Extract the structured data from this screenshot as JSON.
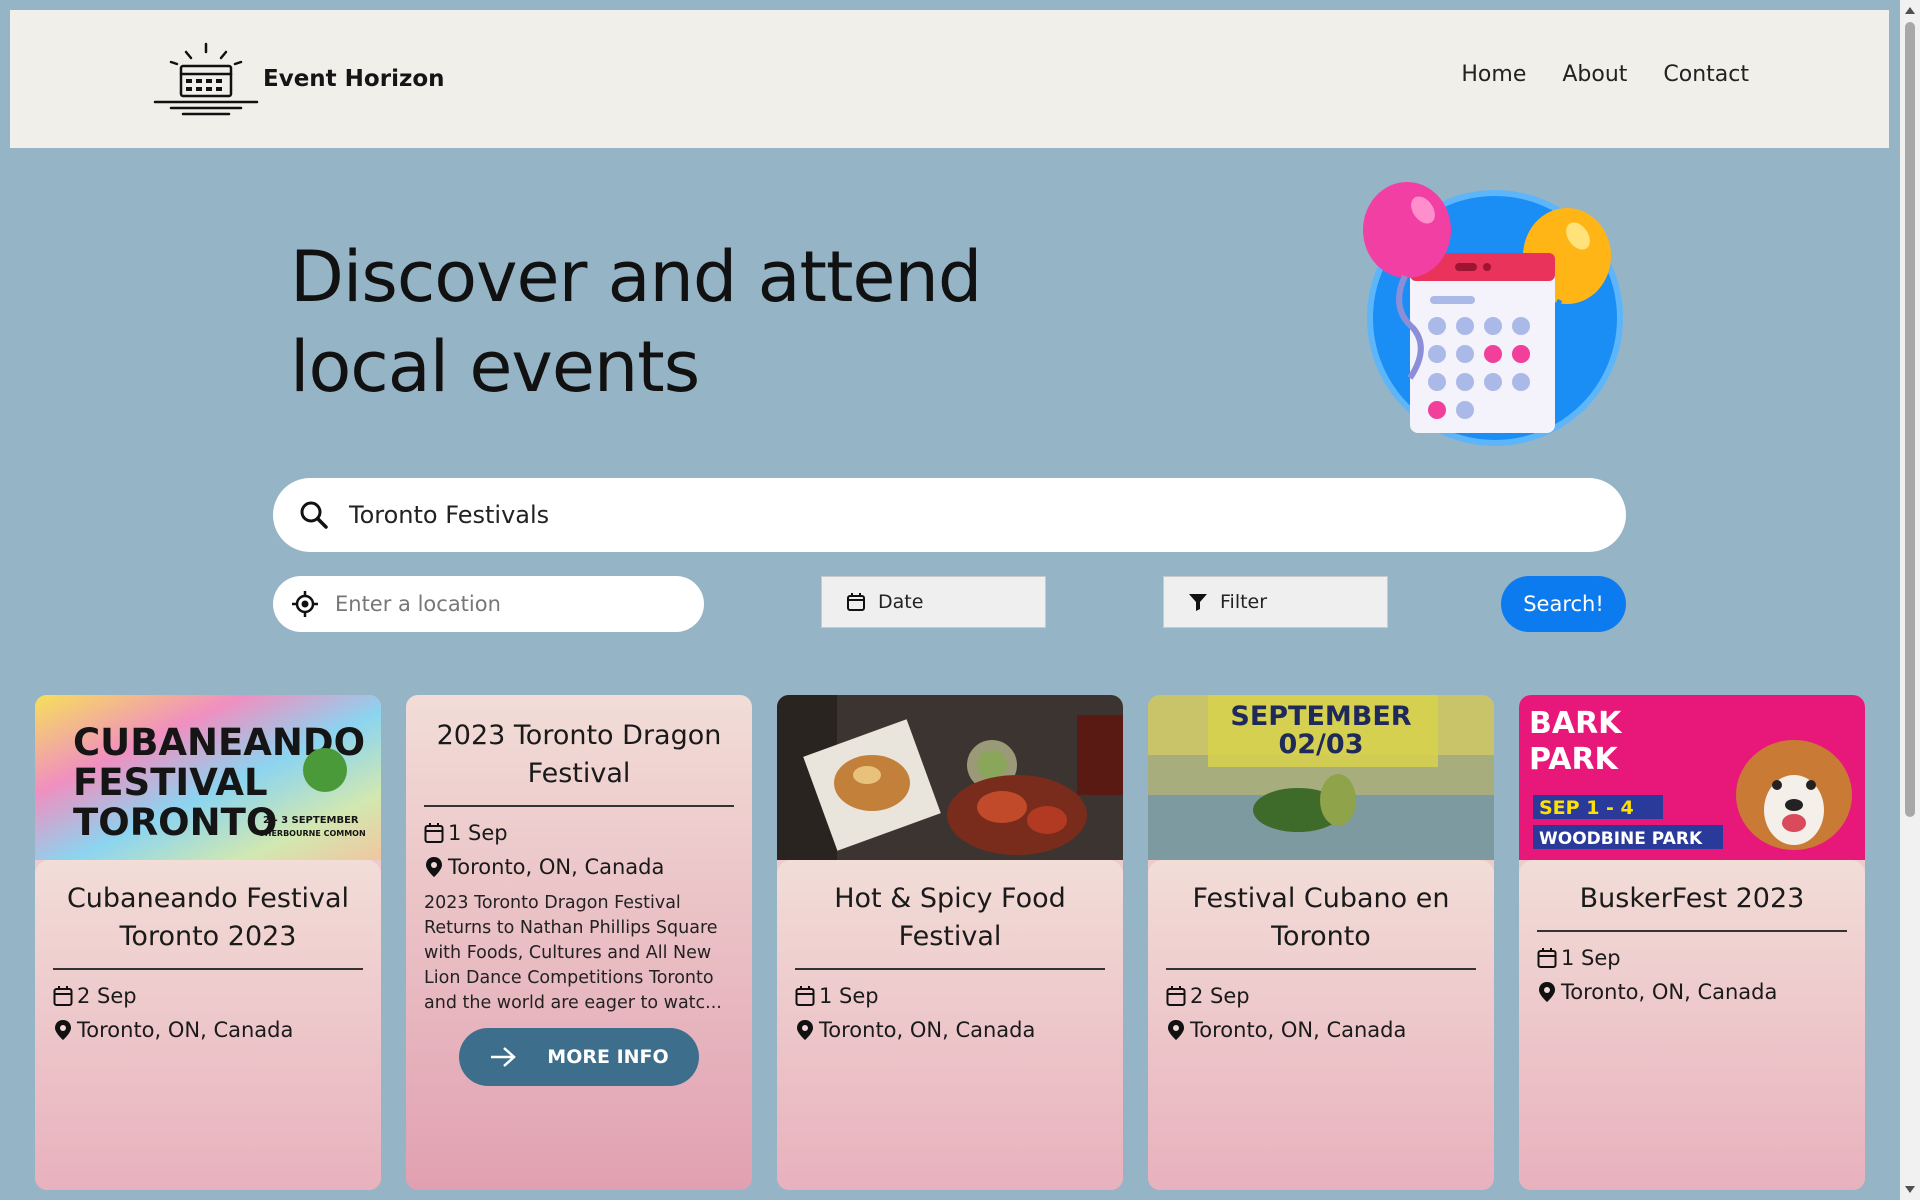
{
  "header": {
    "brand": "Event Horizon",
    "nav": [
      "Home",
      "About",
      "Contact"
    ]
  },
  "hero": {
    "title_line1": "Discover and attend",
    "title_line2": "local events"
  },
  "search": {
    "query": "Toronto Festivals",
    "location_placeholder": "Enter a location",
    "date_label": "Date",
    "filter_label": "Filter",
    "submit_label": "Search!"
  },
  "events": [
    {
      "title": "Cubaneando Festival Toronto 2023",
      "date": "2 Sep",
      "location": "Toronto, ON, Canada",
      "poster_lines": [
        "CUBANEANDO",
        "FESTIVAL",
        "TORONTO"
      ],
      "poster_date": "2 - 3 SEPTEMBER",
      "poster_venue": "SHERBOURNE COMMON"
    },
    {
      "title": "2023 Toronto Dragon Festival",
      "date": "1 Sep",
      "location": "Toronto, ON, Canada",
      "description": "2023 Toronto Dragon Festival Returns to Nathan Phillips Square with Foods, Cultures and All New Lion Dance Competitions Toronto and the world are eager to watc...",
      "button": "MORE INFO"
    },
    {
      "title": "Hot & Spicy Food Festival",
      "date": "1 Sep",
      "location": "Toronto, ON, Canada"
    },
    {
      "title": "Festival Cubano en Toronto",
      "date": "2 Sep",
      "location": "Toronto, ON, Canada",
      "poster_lines": [
        "SEPTEMBER",
        "02/03"
      ]
    },
    {
      "title": "BuskerFest 2023",
      "date": "1 Sep",
      "location": "Toronto, ON, Canada",
      "poster_lines": [
        "BARK",
        "PARK"
      ],
      "poster_date": "SEP 1 - 4",
      "poster_venue": "WOODBINE PARK"
    }
  ],
  "colors": {
    "background": "#95b4c6",
    "header": "#f0efea",
    "accent": "#0d7bf0",
    "button": "#3d6f8c"
  }
}
